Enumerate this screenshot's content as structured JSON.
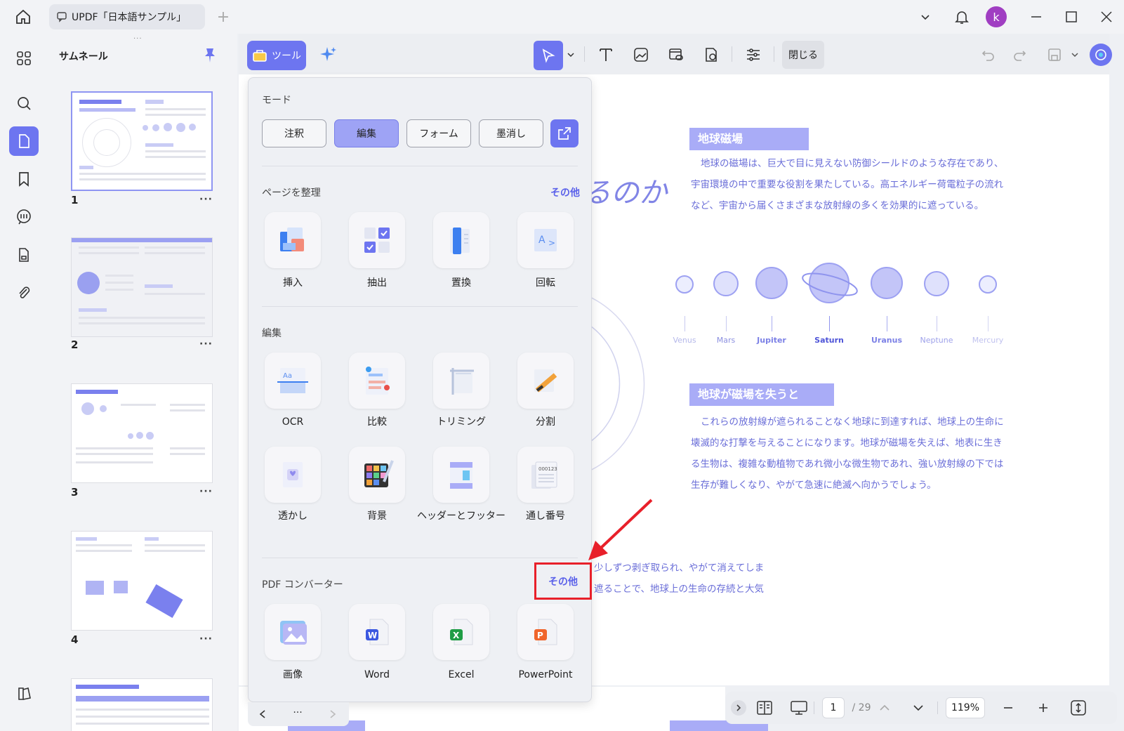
{
  "window": {
    "tab_title": "UPDF「日本語サンプル」",
    "avatar_letter": "k"
  },
  "thumbnails": {
    "title": "サムネール",
    "pages": [
      "1",
      "2",
      "3",
      "4"
    ],
    "page_menu": "···"
  },
  "toolbar": {
    "tools_label": "ツール",
    "close_label": "閉じる"
  },
  "popup": {
    "mode_title": "モード",
    "modes": [
      "注釈",
      "編集",
      "フォーム",
      "墨消し"
    ],
    "organize": {
      "title": "ページを整理",
      "more": "その他",
      "items": [
        "挿入",
        "抽出",
        "置換",
        "回転"
      ]
    },
    "edit": {
      "title": "編集",
      "items": [
        "OCR",
        "比較",
        "トリミング",
        "分割",
        "透かし",
        "背景",
        "ヘッダーとフッター",
        "通し番号"
      ]
    },
    "converter": {
      "title": "PDF コンバーター",
      "more": "その他",
      "items": [
        "画像",
        "Word",
        "Excel",
        "PowerPoint"
      ]
    }
  },
  "document": {
    "heading_partial": "るのか",
    "section1": {
      "heading": "地球磁場",
      "lines": [
        "地球の磁場は、巨大で目に見えない防御シールドのような存在であり、",
        "宇宙環境の中で重要な役割を果たしている。高エネルギー荷電粒子の流れ",
        "など、宇宙から届くさまざまな放射線の多くを効果的に遮っている。"
      ]
    },
    "planets": [
      "Venus",
      "Mars",
      "Jupiter",
      "Saturn",
      "Uranus",
      "Neptune",
      "Mercury"
    ],
    "section2": {
      "heading": "地球が磁場を失うと",
      "lines": [
        "これらの放射線が遮られることなく地球に到達すれば、地球上の生命に",
        "壊滅的な打撃を与えることになります。地球が磁場を失えば、地表に生き",
        "る生物は、複雑な動植物であれ微小な微生物であれ、強い放射線の下では",
        "生存が難しくなり、やがて急速に絶滅へ向かうでしょう。"
      ]
    },
    "partial_lines": [
      "少しずつ剥ぎ取られ、やがて消えてしま",
      "遮ることで、地球上の生命の存続と大気"
    ]
  },
  "statusbar": {
    "current_page": "1",
    "total_pages": "/ 29",
    "zoom": "119%"
  },
  "colors": {
    "accent": "#6d75f0",
    "highlight_box": "#e8202a",
    "doc_text": "#6a6ed8"
  }
}
